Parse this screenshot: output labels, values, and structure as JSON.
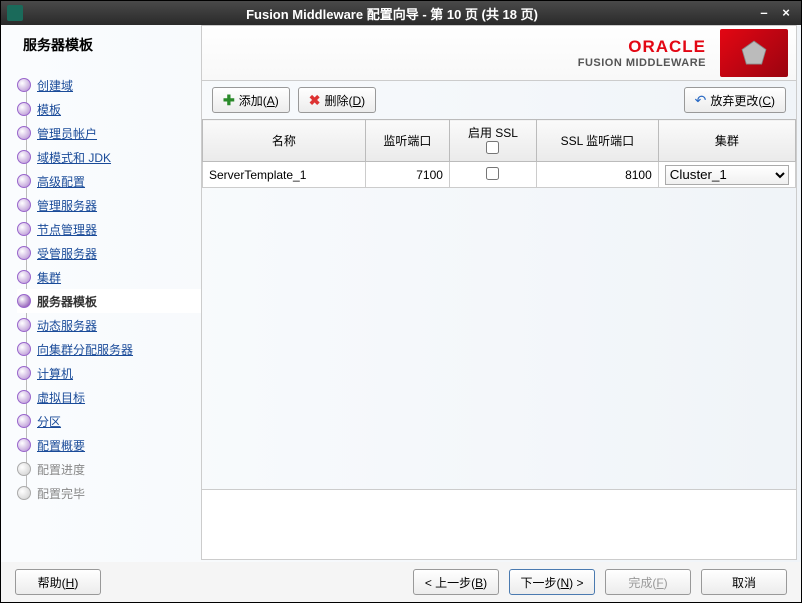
{
  "title": "Fusion Middleware 配置向导 - 第 10 页 (共 18 页)",
  "sidebar": {
    "title": "服务器模板",
    "steps": [
      {
        "label": "创建域",
        "state": "done"
      },
      {
        "label": "模板",
        "state": "done"
      },
      {
        "label": "管理员帐户",
        "state": "done"
      },
      {
        "label": "域模式和 JDK",
        "state": "done"
      },
      {
        "label": "高级配置",
        "state": "done"
      },
      {
        "label": "管理服务器",
        "state": "done"
      },
      {
        "label": "节点管理器",
        "state": "done"
      },
      {
        "label": "受管服务器",
        "state": "done"
      },
      {
        "label": "集群",
        "state": "done"
      },
      {
        "label": "服务器模板",
        "state": "current"
      },
      {
        "label": "动态服务器",
        "state": "todo"
      },
      {
        "label": "向集群分配服务器",
        "state": "todo"
      },
      {
        "label": "计算机",
        "state": "todo"
      },
      {
        "label": "虚拟目标",
        "state": "todo"
      },
      {
        "label": "分区",
        "state": "todo"
      },
      {
        "label": "配置概要",
        "state": "todo"
      },
      {
        "label": "配置进度",
        "state": "disabled"
      },
      {
        "label": "配置完毕",
        "state": "disabled"
      }
    ]
  },
  "branding": {
    "oracle": "ORACLE",
    "sub": "FUSION MIDDLEWARE"
  },
  "toolbar": {
    "add": "添加(",
    "add_key": "A",
    "add_suffix": ")",
    "delete": "删除(",
    "delete_key": "D",
    "delete_suffix": ")",
    "discard": "放弃更改(",
    "discard_key": "C",
    "discard_suffix": ")"
  },
  "table": {
    "headers": {
      "name": "名称",
      "listen_port": "监听端口",
      "enable_ssl": "启用 SSL",
      "ssl_port": "SSL 监听端口",
      "cluster": "集群"
    },
    "rows": [
      {
        "name": "ServerTemplate_1",
        "listen_port": "7100",
        "enable_ssl": false,
        "ssl_port": "8100",
        "cluster": "Cluster_1"
      }
    ]
  },
  "footer": {
    "help": "帮助(",
    "help_key": "H",
    "back": "< 上一步(",
    "back_key": "B",
    "next": "下一步(",
    "next_key": "N",
    "next_suffix": ") >",
    "finish": "完成(",
    "finish_key": "F",
    "cancel": "取消"
  }
}
